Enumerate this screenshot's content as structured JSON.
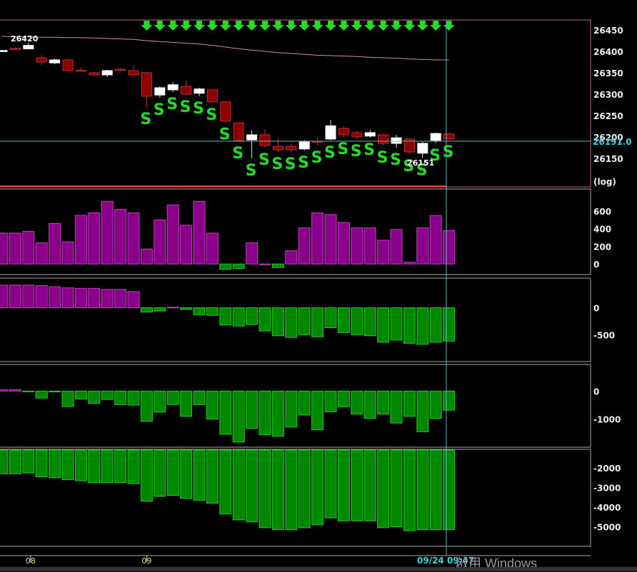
{
  "price_axis": {
    "ticks": [
      26450,
      26400,
      26350,
      26300,
      26250,
      26200,
      26150
    ],
    "current": "26191.0",
    "scale_label": "(log)",
    "high_label": "26420",
    "low_label": "26151"
  },
  "signal_label": "S",
  "time_axis": {
    "labels": [
      {
        "bar": 2,
        "text": "08"
      },
      {
        "bar": 11,
        "text": "09"
      }
    ],
    "cursor_label": "09/24 09:47"
  },
  "watermark": "啟用 Windows",
  "colors": {
    "up": "#ffffff",
    "down": "#8b0000",
    "pos": "#8b008b",
    "neg": "#008800",
    "signal": "#22dd22",
    "cursor": "#5fb8c0"
  },
  "chart_data": {
    "type": "candlestick",
    "candles": [
      [
        26400,
        26402,
        26398,
        26403
      ],
      [
        26407,
        26406,
        26409,
        26405
      ],
      [
        26406,
        26414,
        26420,
        26404
      ],
      [
        26385,
        26375,
        26392,
        26368
      ],
      [
        26373,
        26380,
        26383,
        26370
      ],
      [
        26380,
        26355,
        26382,
        26353
      ],
      [
        26356,
        26354,
        26362,
        26352
      ],
      [
        26350,
        26345,
        26353,
        26342
      ],
      [
        26345,
        26355,
        26357,
        26340
      ],
      [
        26358,
        26356,
        26361,
        26354
      ],
      [
        26355,
        26345,
        26368,
        26343
      ],
      [
        26350,
        26295,
        26352,
        26270
      ],
      [
        26298,
        26315,
        26318,
        26292
      ],
      [
        26310,
        26322,
        26328,
        26305
      ],
      [
        26318,
        26300,
        26333,
        26298
      ],
      [
        26302,
        26312,
        26315,
        26295
      ],
      [
        26310,
        26282,
        26311,
        26280
      ],
      [
        26282,
        26237,
        26283,
        26234
      ],
      [
        26233,
        26192,
        26235,
        26190
      ],
      [
        26193,
        26205,
        26215,
        26150
      ],
      [
        26205,
        26180,
        26218,
        26175
      ],
      [
        26178,
        26170,
        26196,
        26165
      ],
      [
        26178,
        26170,
        26185,
        26165
      ],
      [
        26172,
        26190,
        26193,
        26168
      ],
      [
        26190,
        26189,
        26198,
        26180
      ],
      [
        26195,
        26226,
        26240,
        26192
      ],
      [
        26220,
        26205,
        26225,
        26200
      ],
      [
        26210,
        26200,
        26215,
        26195
      ],
      [
        26202,
        26210,
        26216,
        26198
      ],
      [
        26205,
        26185,
        26207,
        26180
      ],
      [
        26185,
        26198,
        26205,
        26175
      ],
      [
        26195,
        26165,
        26197,
        26160
      ],
      [
        26162,
        26185,
        26188,
        26151
      ],
      [
        26192,
        26208,
        26210,
        26185
      ],
      [
        26207,
        26195,
        26209,
        26193
      ]
    ],
    "ma": [
      26435,
      26434,
      26434,
      26433,
      26433,
      26432,
      26432,
      26431,
      26430,
      26429,
      26428,
      26425,
      26423,
      26421,
      26419,
      26417,
      26414,
      26410,
      26406,
      26403,
      26400,
      26397,
      26395,
      26393,
      26391,
      26390,
      26389,
      26388,
      26386,
      26385,
      26384,
      26382,
      26381,
      26380,
      26380
    ],
    "signals": [
      11,
      12,
      13,
      14,
      15,
      16,
      17,
      18,
      19,
      20,
      21,
      22,
      23,
      24,
      25,
      26,
      27,
      28,
      29,
      30,
      31,
      32,
      33,
      34
    ],
    "panes": [
      {
        "ticks": [
          600,
          400,
          200,
          0
        ],
        "range": [
          -120,
          850
        ],
        "values": [
          350,
          350,
          370,
          240,
          460,
          250,
          550,
          580,
          710,
          620,
          580,
          170,
          500,
          670,
          440,
          710,
          350,
          -60,
          -50,
          240,
          0,
          -40,
          150,
          410,
          580,
          560,
          470,
          410,
          410,
          270,
          390,
          20,
          410,
          550,
          380
        ]
      },
      {
        "ticks": [
          0,
          -500
        ],
        "range": [
          -1000,
          550
        ],
        "values": [
          420,
          420,
          420,
          410,
          390,
          370,
          360,
          360,
          340,
          340,
          300,
          -80,
          -60,
          10,
          -30,
          -130,
          -140,
          -320,
          -340,
          -310,
          -430,
          -520,
          -550,
          -500,
          -540,
          -370,
          -460,
          -500,
          -520,
          -640,
          -600,
          -660,
          -680,
          -640,
          -620
        ]
      },
      {
        "ticks": [
          0,
          -1000
        ],
        "range": [
          -2000,
          950
        ],
        "values": [
          50,
          50,
          -10,
          -250,
          -30,
          -550,
          -280,
          -440,
          -300,
          -480,
          -500,
          -1080,
          -750,
          -480,
          -900,
          -480,
          -1000,
          -1540,
          -1820,
          -1330,
          -1560,
          -1610,
          -1280,
          -850,
          -1380,
          -740,
          -560,
          -820,
          -970,
          -820,
          -1140,
          -900,
          -1450,
          -970,
          -680
        ]
      },
      {
        "ticks": [
          -2000,
          -3000,
          -4000,
          -5000
        ],
        "range": [
          -6000,
          -1050
        ],
        "values": [
          -2300,
          -2300,
          -2250,
          -2450,
          -2500,
          -2600,
          -2650,
          -2750,
          -2750,
          -2750,
          -2800,
          -3700,
          -3450,
          -3400,
          -3550,
          -3650,
          -3800,
          -4350,
          -4650,
          -4750,
          -5050,
          -5150,
          -5150,
          -5050,
          -4900,
          -4550,
          -4700,
          -4700,
          -4700,
          -5050,
          -5000,
          -5200,
          -5150,
          -5150,
          -5150
        ]
      }
    ]
  }
}
